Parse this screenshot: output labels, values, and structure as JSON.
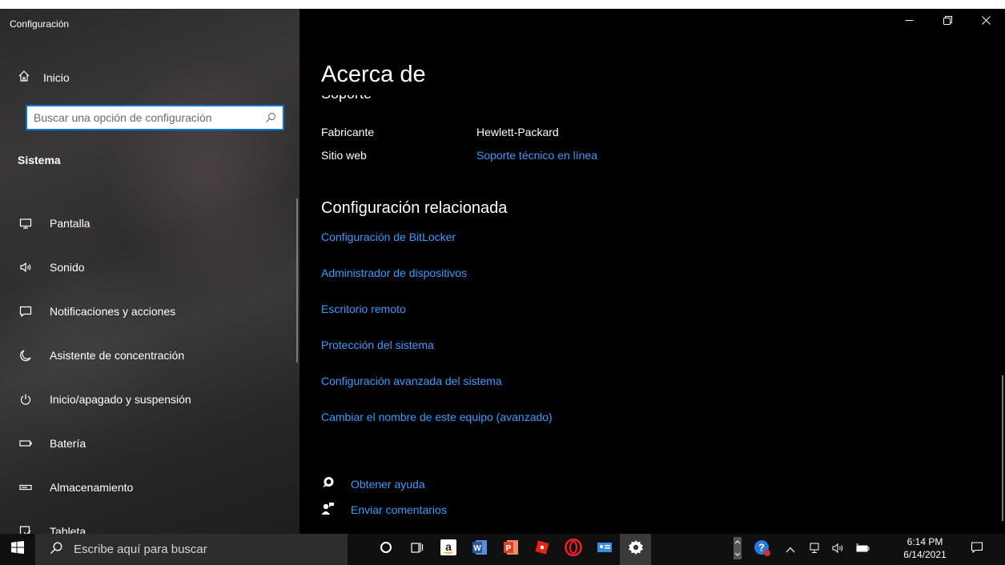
{
  "window": {
    "title": "Configuración",
    "controls": {
      "minimize": "minimize-icon",
      "maximize": "restore-icon",
      "close": "close-icon"
    }
  },
  "sidebar": {
    "home_label": "Inicio",
    "search_placeholder": "Buscar una opción de configuración",
    "section_title": "Sistema",
    "items": [
      {
        "label": "Pantalla",
        "icon": "display-icon"
      },
      {
        "label": "Sonido",
        "icon": "speaker-icon"
      },
      {
        "label": "Notificaciones y acciones",
        "icon": "notification-icon"
      },
      {
        "label": "Asistente de concentración",
        "icon": "moon-icon"
      },
      {
        "label": "Inicio/apagado y suspensión",
        "icon": "power-icon"
      },
      {
        "label": "Batería",
        "icon": "battery-icon"
      },
      {
        "label": "Almacenamiento",
        "icon": "storage-icon"
      },
      {
        "label": "Tableta",
        "icon": "tablet-icon"
      }
    ]
  },
  "main": {
    "page_title": "Acerca de",
    "clipped_heading": "Soporte",
    "support": {
      "manufacturer_label": "Fabricante",
      "manufacturer_value": "Hewlett-Packard",
      "website_label": "Sitio web",
      "website_value": "Soporte técnico en línea"
    },
    "related_title": "Configuración relacionada",
    "related_links": [
      "Configuración de BitLocker",
      "Administrador de dispositivos",
      "Escritorio remoto",
      "Protección del sistema",
      "Configuración avanzada del sistema",
      "Cambiar el nombre de este equipo (avanzado)"
    ],
    "help": {
      "get_help": "Obtener ayuda",
      "feedback": "Enviar comentarios"
    }
  },
  "taskbar": {
    "search_placeholder": "Escribe aquí para buscar",
    "apps": [
      "cortana-icon",
      "task-view-icon",
      "amazon-icon",
      "word-icon",
      "powerpoint-icon",
      "roblox-icon",
      "opera-icon",
      "contact-card-icon",
      "settings-icon"
    ],
    "time": "6:14 PM",
    "date": "6/14/2021"
  },
  "colors": {
    "accent": "#0078d7",
    "link": "#3b9bff",
    "background": "#000000"
  }
}
